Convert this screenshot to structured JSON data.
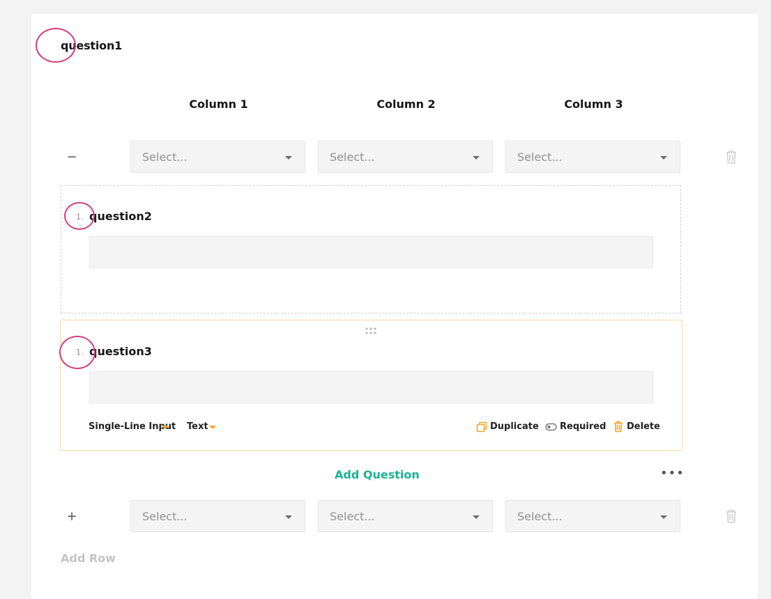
{
  "question1": {
    "title": "question1"
  },
  "columns": [
    "Column 1",
    "Column 2",
    "Column 3"
  ],
  "select_placeholder": "Select...",
  "row1": {
    "toggle": "−"
  },
  "row2": {
    "toggle": "+"
  },
  "question2": {
    "number": "1.",
    "title": "question2"
  },
  "question3": {
    "number": "1.",
    "title": "question3",
    "type_label": "Single-Line Input",
    "input_type_label": "Text",
    "duplicate_label": "Duplicate",
    "required_label": "Required",
    "delete_label": "Delete"
  },
  "add_question_label": "Add Question",
  "more_label": "•••",
  "add_row_label": "Add Row",
  "colors": {
    "accent": "#19b394",
    "warning": "#f5a623",
    "annotation": "#d63c7c"
  }
}
